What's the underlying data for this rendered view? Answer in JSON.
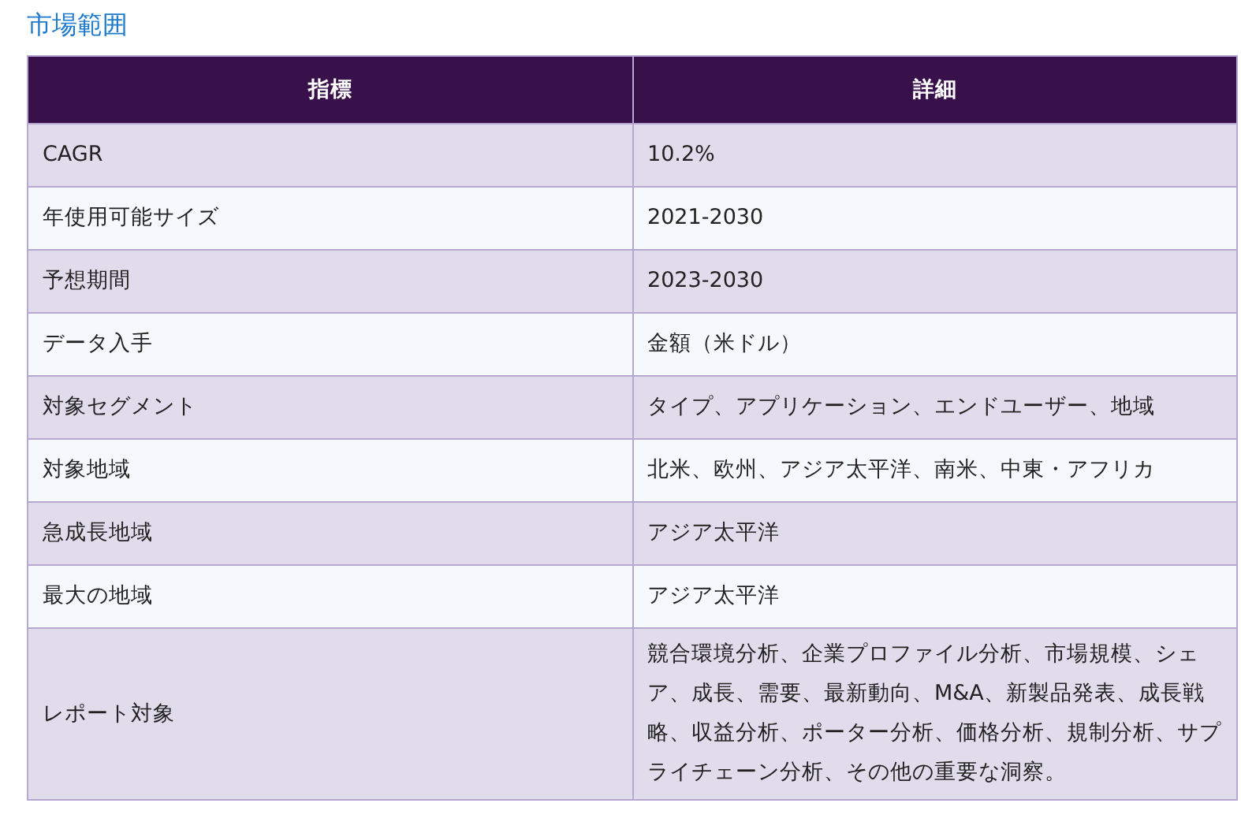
{
  "title": "市場範囲",
  "table": {
    "columns": [
      "指標",
      "詳細"
    ],
    "rows": [
      [
        "CAGR",
        "10.2%"
      ],
      [
        "年使用可能サイズ",
        "2021-2030"
      ],
      [
        "予想期間",
        "2023-2030"
      ],
      [
        "データ入手",
        "金額（米ドル）"
      ],
      [
        "対象セグメント",
        "タイプ、アプリケーション、エンドユーザー、地域"
      ],
      [
        "対象地域",
        "北米、欧州、アジア太平洋、南米、中東・アフリカ"
      ],
      [
        "急成長地域",
        "アジア太平洋"
      ],
      [
        "最大の地域",
        "アジア太平洋"
      ],
      [
        "レポート対象",
        "競合環境分析、企業プロファイル分析、市場規模、シェア、成長、需要、最新動向、M&A、新製品発表、成長戦略、収益分析、ポーター分析、価格分析、規制分析、サプライチェーン分析、その他の重要な洞察。"
      ]
    ]
  }
}
